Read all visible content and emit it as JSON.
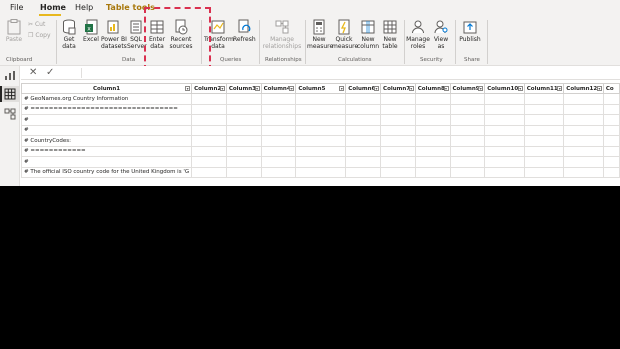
{
  "menu": {
    "file": "File",
    "home": "Home",
    "help": "Help",
    "table_tools": "Table tools"
  },
  "ribbon": {
    "clipboard": {
      "paste": "Paste",
      "cut": "Cut",
      "copy": "Copy",
      "group": "Clipboard"
    },
    "data": {
      "get_data": [
        "Get",
        "data"
      ],
      "excel": "Excel",
      "power_bi": [
        "Power BI",
        "datasets"
      ],
      "sql": [
        "SQL",
        "Server"
      ],
      "enter_data": [
        "Enter",
        "data"
      ],
      "recent_sources": [
        "Recent",
        "sources"
      ],
      "group": "Data"
    },
    "queries": {
      "transform": [
        "Transform",
        "data"
      ],
      "refresh": "Refresh",
      "group": "Queries"
    },
    "relationships": {
      "manage": [
        "Manage",
        "relationships"
      ],
      "group": "Relationships"
    },
    "calculations": {
      "new_measure": [
        "New",
        "measure"
      ],
      "quick_measure": [
        "Quick",
        "measure"
      ],
      "new_column": [
        "New",
        "column"
      ],
      "new_table": [
        "New",
        "table"
      ],
      "group": "Calculations"
    },
    "security": {
      "manage_roles": [
        "Manage",
        "roles"
      ],
      "view_as": [
        "View",
        "as"
      ],
      "group": "Security"
    },
    "share": {
      "publish": "Publish",
      "group": "Share"
    }
  },
  "formula": {
    "cancel": "✕",
    "commit": "✓"
  },
  "grid": {
    "columns": [
      "Column1",
      "Column2",
      "Column3",
      "Column4",
      "Column5",
      "Column6",
      "Column7",
      "Column8",
      "Column9",
      "Column10",
      "Column11",
      "Column12",
      "Co"
    ],
    "rows": [
      "# GeoNames.org Country Information",
      "# ================================",
      "#",
      "#",
      "# CountryCodes:",
      "# ============",
      "#",
      "# The official ISO country code for the United Kingdom is 'G"
    ]
  },
  "colors": {
    "accent": "#e8b81e",
    "highlight": "#d9304f",
    "ribbon_bg": "#f3f2f1"
  }
}
